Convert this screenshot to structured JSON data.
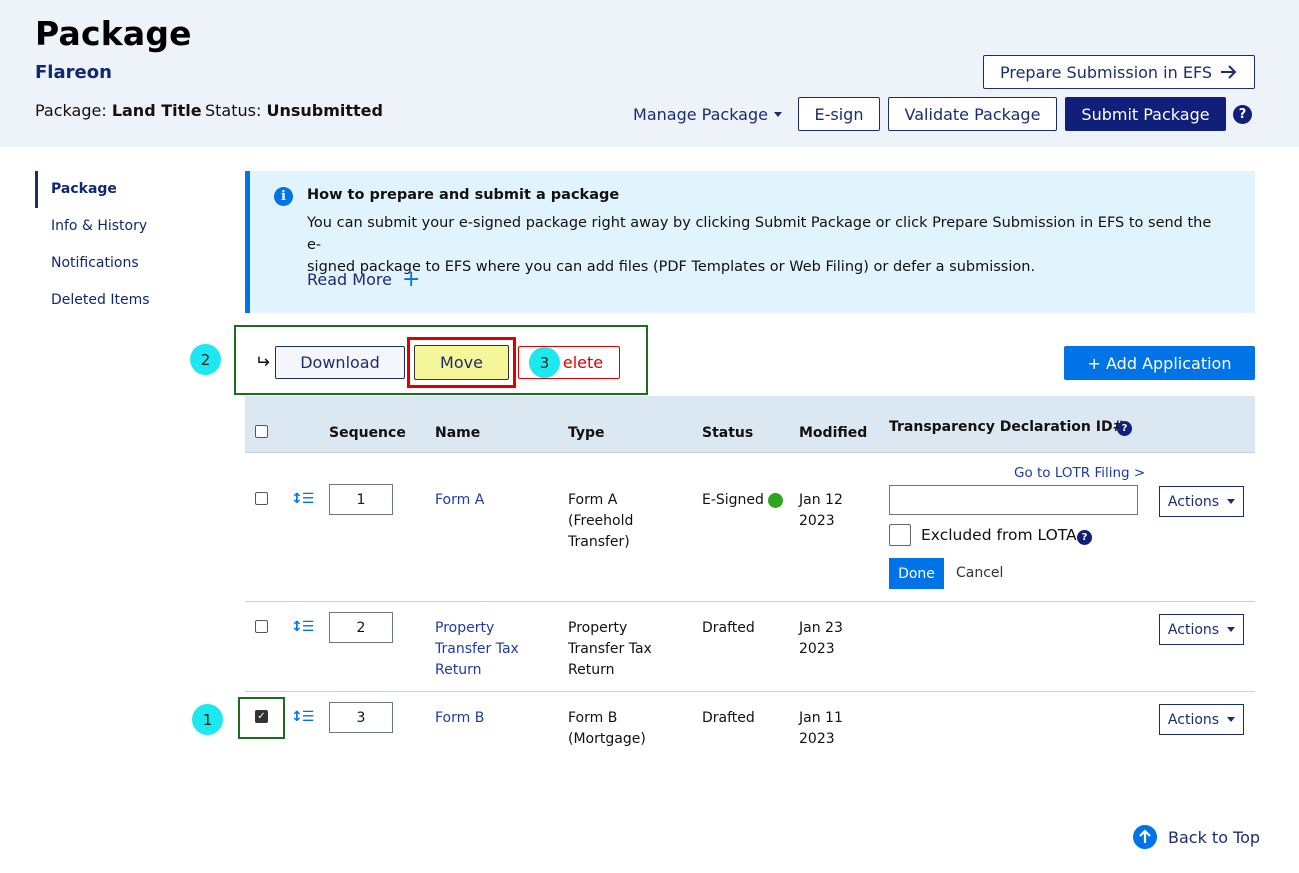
{
  "header": {
    "title": "Package",
    "org": "Flareon",
    "package_label": "Package:",
    "package_value": "Land Title",
    "status_label": "Status:",
    "status_value": "Unsubmitted",
    "prepare_btn": "Prepare Submission in EFS",
    "manage_btn": "Manage Package",
    "esign_btn": "E-sign",
    "validate_btn": "Validate Package",
    "submit_btn": "Submit Package",
    "help": "?"
  },
  "sidebar": {
    "items": [
      {
        "label": "Package"
      },
      {
        "label": "Info & History"
      },
      {
        "label": "Notifications"
      },
      {
        "label": "Deleted Items"
      }
    ]
  },
  "info": {
    "icon": "i",
    "title": "How to prepare and submit a package",
    "line1": "You can submit your e-signed package right away by clicking Submit Package or click Prepare Submission in EFS to send the e-",
    "line2": "signed package to EFS where you can add files (PDF Templates or Web Filing) or defer a submission.",
    "read_more": "Read More",
    "plus": "+"
  },
  "toolbar": {
    "download": "Download",
    "move": "Move",
    "delete": "elete",
    "add_app": "+ Add Application",
    "arrow": "↵"
  },
  "markers": {
    "m1": "1",
    "m2": "2",
    "m3": "3"
  },
  "table": {
    "headers": {
      "sequence": "Sequence",
      "name": "Name",
      "type": "Type",
      "status": "Status",
      "modified": "Modified",
      "transparency": "Transparency Declaration ID#"
    },
    "rows": [
      {
        "seq": "1",
        "name": [
          "Form A"
        ],
        "type": [
          "Form A",
          "(Freehold",
          "Transfer)"
        ],
        "status": "E-Signed",
        "modified": [
          "Jan 12",
          "2023"
        ],
        "checked": false
      },
      {
        "seq": "2",
        "name": [
          "Property",
          "Transfer Tax",
          "Return"
        ],
        "type": [
          "Property",
          "Transfer Tax",
          "Return"
        ],
        "status": "Drafted",
        "modified": [
          "Jan 23",
          "2023"
        ],
        "checked": false
      },
      {
        "seq": "3",
        "name": [
          "Form B"
        ],
        "type": [
          "Form B",
          "(Mortgage)"
        ],
        "status": "Drafted",
        "modified": [
          "Jan 11",
          "2023"
        ],
        "checked": true
      }
    ],
    "actions_label": "Actions",
    "lotr_link": "Go to LOTR Filing >",
    "excluded_label": "Excluded from LOTA",
    "done": "Done",
    "cancel": "Cancel",
    "seq_icon": "↕☰"
  },
  "footer": {
    "back_to_top": "Back to Top"
  },
  "colors": {
    "brand_navy": "#0f1f7a",
    "accent_blue": "#0073e6",
    "info_bg": "#e1f4fd",
    "highlight_yellow": "#f5f59a",
    "delete_red": "#e00000",
    "esigned_green": "#2ea51f"
  }
}
